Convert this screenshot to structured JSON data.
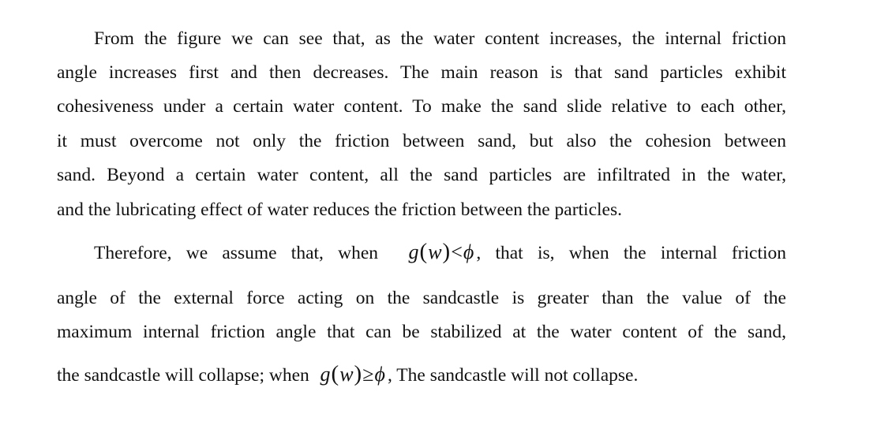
{
  "paragraph1": {
    "lines": [
      "From the figure we can see that, as the water content increases, the internal friction",
      "angle increases first and then decreases. The main reason is that sand particles exhibit",
      "cohesiveness under a certain water content. To make the sand slide relative to each other,",
      "it must overcome not only the friction between sand, but also the cohesion between",
      "sand. Beyond a certain water content, all the sand particles are infiltrated in the water,",
      "and the lubricating effect of water reduces the friction between the particles."
    ]
  },
  "paragraph2": {
    "line1_before": "Therefore, we assume that, when",
    "line1_math": {
      "func": "g",
      "open": "(",
      "var": "w",
      "close": ")",
      "op": "<",
      "sym": "ϕ"
    },
    "line1_after": ", that is, when the internal friction",
    "lines": [
      "angle of the external force acting on the sandcastle is greater than the value of the",
      "maximum internal friction angle that can be stabilized at the water content of the sand,"
    ],
    "last_before": "the sandcastle will collapse; when",
    "last_math": {
      "func": "g",
      "open": "(",
      "var": "w",
      "close": ")",
      "op": "≥",
      "sym": "ϕ"
    },
    "last_after": ", The sandcastle will not collapse."
  }
}
